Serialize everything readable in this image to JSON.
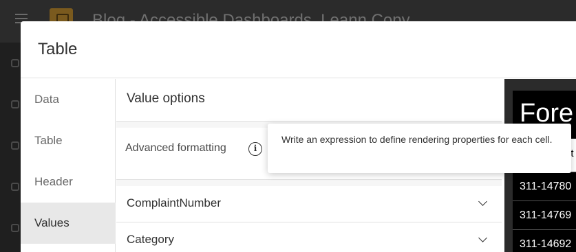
{
  "app": {
    "title": "Blog - Accessible Dashboards_Leann Copy"
  },
  "modal": {
    "title": "Table"
  },
  "nav": {
    "items": [
      {
        "label": "Data"
      },
      {
        "label": "Table"
      },
      {
        "label": "Header"
      },
      {
        "label": "Values"
      }
    ],
    "active": "Values"
  },
  "settings": {
    "section_title": "Value options",
    "advanced_formatting_label": "Advanced formatting",
    "fields": [
      {
        "label": "ComplaintNumber"
      },
      {
        "label": "Category"
      }
    ]
  },
  "tooltip": {
    "text": "Write an expression to define rendering properties for each cell."
  },
  "preview": {
    "title": "Fore",
    "header_cell": "nt",
    "rows": [
      {
        "value": "311-14780"
      },
      {
        "value": "311-14769"
      },
      {
        "value": "311-14692"
      }
    ]
  },
  "colors": {
    "modal_bg": "#ffffff",
    "nav_active_bg": "#e8e8e8",
    "preview_bg": "#000000",
    "overlay": "#3a3a3a"
  }
}
